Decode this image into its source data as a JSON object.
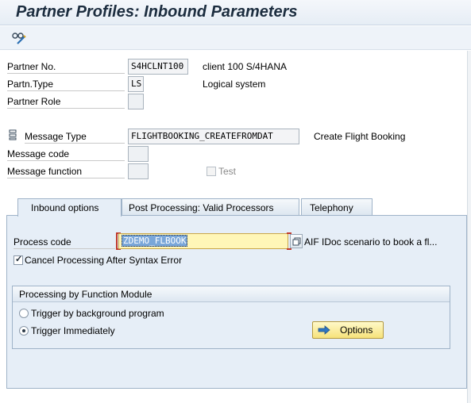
{
  "window": {
    "title": "Partner Profiles: Inbound Parameters"
  },
  "toolbar": {
    "other_icon": "glasses-edit-icon"
  },
  "fields": {
    "partner_no": {
      "label": "Partner No.",
      "value": "S4HCLNT100",
      "desc": "client 100 S/4HANA"
    },
    "partner_type": {
      "label": "Partn.Type",
      "value": "LS",
      "desc": "Logical system"
    },
    "partner_role": {
      "label": "Partner Role",
      "value": ""
    },
    "message_type": {
      "label": "Message Type",
      "value": "FLIGHTBOOKING_CREATEFROMDAT",
      "desc": "Create Flight Booking"
    },
    "message_code": {
      "label": "Message code",
      "value": ""
    },
    "message_function": {
      "label": "Message function",
      "value": ""
    },
    "test": {
      "label": "Test",
      "checked": false
    }
  },
  "tabs": [
    {
      "label": "Inbound options",
      "active": true
    },
    {
      "label": "Post Processing: Valid Processors",
      "active": false
    },
    {
      "label": "Telephony",
      "active": false
    }
  ],
  "inbound": {
    "process_code_label": "Process code",
    "process_code_value": "ZDEMO_FLBOOK",
    "process_code_desc": "AIF IDoc scenario to book a fl...",
    "cancel_label": "Cancel Processing After Syntax Error",
    "cancel_checked": true,
    "group_title": "Processing by Function Module",
    "radio_background": "Trigger by background program",
    "radio_immediately": "Trigger Immediately",
    "options_button": "Options"
  },
  "colors": {
    "accent_yellow": "#fff6b7",
    "panel_blue": "#e6eef7",
    "highlight_red": "#c0392b"
  }
}
